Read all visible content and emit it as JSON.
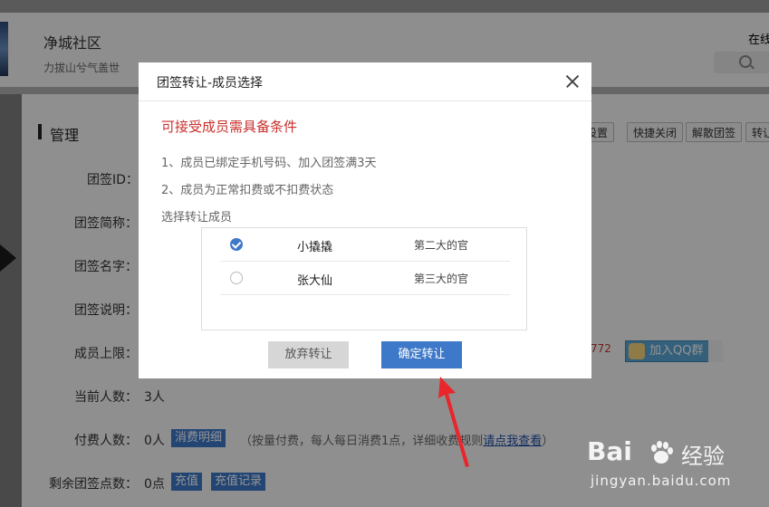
{
  "header": {
    "site_title": "净城社区",
    "site_subtitle": "力拔山兮气盖世",
    "online_label": "在线"
  },
  "section": {
    "title": "管理",
    "buttons": [
      "设置",
      "快捷关闭",
      "解散团签",
      "转让"
    ]
  },
  "form": {
    "rows": [
      {
        "label": "团签ID："
      },
      {
        "label": "团签简称："
      },
      {
        "label": "团签名字："
      },
      {
        "label": "团签说明："
      },
      {
        "label": "成员上限："
      },
      {
        "label": "当前人数：",
        "value": "3人"
      },
      {
        "label": "付费人数：",
        "value": "0人"
      },
      {
        "label": "剩余团签点数：",
        "value": "0点"
      }
    ],
    "consume_detail_btn": "消费明细",
    "paid_note_prefix": "（按量付费，每人每日消费1点，详细收费规则",
    "paid_note_link": "请点我查看",
    "paid_note_suffix": "）",
    "recharge_btn": "充值",
    "recharge_record_btn": "充值记录",
    "qq_number_partial": "772",
    "qq_join_btn": "加入QQ群"
  },
  "modal": {
    "title": "团签转让-成员选择",
    "condition_title": "可接受成员需具备条件",
    "condition_1": "1、成员已绑定手机号码、加入团签满3天",
    "condition_2": "2、成员为正常扣费或不扣费状态",
    "select_label": "选择转让成员",
    "members": [
      {
        "name": "小撬撬",
        "role": "第二大的官",
        "selected": true
      },
      {
        "name": "张大仙",
        "role": "第三大的官",
        "selected": false
      }
    ],
    "cancel_label": "放弃转让",
    "confirm_label": "确定转让"
  },
  "watermark": {
    "logo": "Bai",
    "logo2": "经验",
    "url": "jingyan.baidu.com"
  },
  "colors": {
    "accent": "#3d78c9",
    "warning": "#c9302c",
    "annotation_arrow": "#e8262b"
  }
}
